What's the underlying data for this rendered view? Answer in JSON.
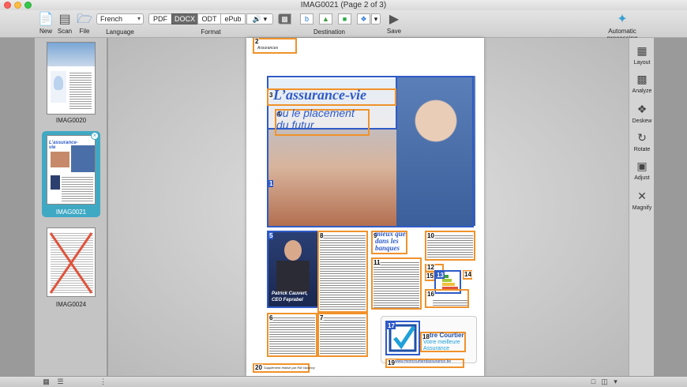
{
  "window": {
    "title": "IMAG0021 (Page 2 of 3)"
  },
  "toolbar": {
    "new_label": "New",
    "scan_label": "Scan",
    "file_label": "File",
    "language_value": "French",
    "language_label": "Language",
    "formats": [
      "PDF",
      "DOCX",
      "ODT",
      "ePub"
    ],
    "active_format": "DOCX",
    "format_label": "Format",
    "destination_label": "Destination",
    "save_label": "Save",
    "auto_label": "Automatic processing"
  },
  "thumbnails": [
    {
      "label": "IMAG0020",
      "selected": false
    },
    {
      "label": "IMAG0021",
      "selected": true
    },
    {
      "label": "IMAG0024",
      "selected": false
    }
  ],
  "document": {
    "header_text": "Assurances",
    "headline": "L’assurance-vie",
    "subheadline_1": "ou le placement",
    "subheadline_2": "du futur",
    "caption_name": "Patrick Cauvert,",
    "caption_role": "CEO Feprabel",
    "pull_quote_1": "mieux que",
    "pull_quote_2": "dans les",
    "pull_quote_3": "banques",
    "ad_title": "tre Courtier",
    "ad_sub_1": "Votre meilleure",
    "ad_sub_2": "Assurance",
    "ad_url": "www.moncourtierdassurance.be",
    "footer_text": "Supplément réalisé par RM Vacancy"
  },
  "region_numbers": [
    "1",
    "2",
    "3",
    "4",
    "5",
    "6",
    "7",
    "8",
    "9",
    "10",
    "11",
    "12",
    "13",
    "14",
    "15",
    "16",
    "17",
    "18",
    "19",
    "20"
  ],
  "right_panel": {
    "layout_label": "Layout",
    "analyze_label": "Analyze",
    "deskew_label": "Deskew",
    "rotate_label": "Rotate",
    "adjust_label": "Adjust",
    "magnify_label": "Magnify"
  },
  "colors": {
    "region_orange": "#f0922b",
    "region_blue": "#2f5bc8",
    "selection": "#3fa9c4"
  }
}
